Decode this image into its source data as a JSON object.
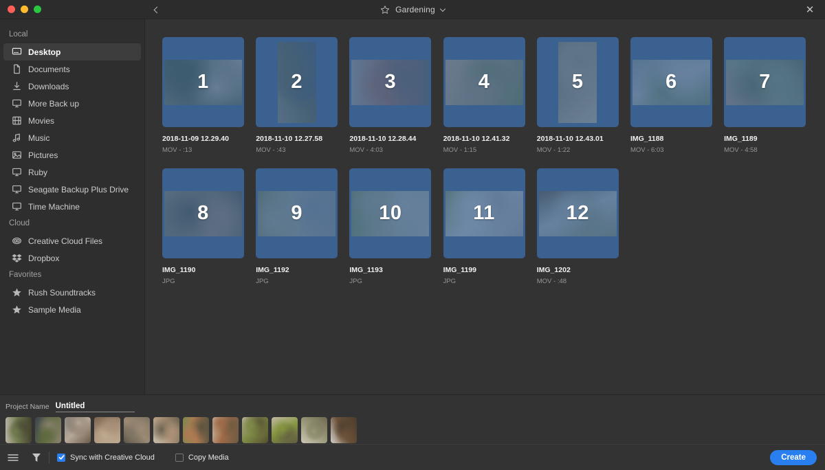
{
  "window": {
    "title": "Gardening",
    "back_icon": "chevron-left-icon",
    "favorite_icon": "star-icon",
    "dropdown_icon": "chevron-down-icon",
    "close_icon": "close-icon"
  },
  "sidebar": {
    "groups": [
      {
        "label": "Local",
        "items": [
          {
            "label": "Desktop",
            "icon": "desktop-icon",
            "selected": true
          },
          {
            "label": "Documents",
            "icon": "document-icon",
            "selected": false
          },
          {
            "label": "Downloads",
            "icon": "download-icon",
            "selected": false
          },
          {
            "label": "More Back up",
            "icon": "display-icon",
            "selected": false
          },
          {
            "label": "Movies",
            "icon": "film-icon",
            "selected": false
          },
          {
            "label": "Music",
            "icon": "music-note-icon",
            "selected": false
          },
          {
            "label": "Pictures",
            "icon": "picture-icon",
            "selected": false
          },
          {
            "label": "Ruby",
            "icon": "display-icon",
            "selected": false
          },
          {
            "label": "Seagate Backup Plus Drive",
            "icon": "display-icon",
            "selected": false
          },
          {
            "label": "Time Machine",
            "icon": "display-icon",
            "selected": false
          }
        ]
      },
      {
        "label": "Cloud",
        "items": [
          {
            "label": "Creative Cloud Files",
            "icon": "creative-cloud-icon",
            "selected": false
          },
          {
            "label": "Dropbox",
            "icon": "dropbox-icon",
            "selected": false
          }
        ]
      },
      {
        "label": "Favorites",
        "items": [
          {
            "label": "Rush Soundtracks",
            "icon": "star-filled-icon",
            "selected": false
          },
          {
            "label": "Sample Media",
            "icon": "star-filled-icon",
            "selected": false
          }
        ]
      }
    ]
  },
  "media_grid": {
    "items": [
      {
        "number": "1",
        "name": "2018-11-09 12.29.40",
        "meta": "MOV - :13",
        "aspect": "wide",
        "c1": "#4c5a4a",
        "c2": "#6d6f62",
        "c3": "#9a9a94"
      },
      {
        "number": "2",
        "name": "2018-11-10 12.27.58",
        "meta": "MOV - :43",
        "aspect": "portrait",
        "c1": "#5d6456",
        "c2": "#7d8075",
        "c3": "#49586b"
      },
      {
        "number": "3",
        "name": "2018-11-10 12.28.44",
        "meta": "MOV - 4:03",
        "aspect": "wide",
        "c1": "#8a6860",
        "c2": "#8e8e8e",
        "c3": "#5c6066"
      },
      {
        "number": "4",
        "name": "2018-11-10 12.41.32",
        "meta": "MOV - 1:15",
        "aspect": "wide",
        "c1": "#8c8476",
        "c2": "#a09684",
        "c3": "#6b7a5c"
      },
      {
        "number": "5",
        "name": "2018-11-10 12.43.01",
        "meta": "MOV - 1:22",
        "aspect": "portrait",
        "c1": "#8a8478",
        "c2": "#6e6a60",
        "c3": "#a5a096"
      },
      {
        "number": "6",
        "name": "IMG_1188",
        "meta": "MOV - 6:03",
        "aspect": "wide",
        "c1": "#9aa0a6",
        "c2": "#7e8a8e",
        "c3": "#6c8068"
      },
      {
        "number": "7",
        "name": "IMG_1189",
        "meta": "MOV - 4:58",
        "aspect": "wide",
        "c1": "#7c8a74",
        "c2": "#96867a",
        "c3": "#5f6c58"
      },
      {
        "number": "8",
        "name": "IMG_1190",
        "meta": "JPG",
        "aspect": "wide",
        "c1": "#8a7e70",
        "c2": "#6e7462",
        "c3": "#53584e"
      },
      {
        "number": "9",
        "name": "IMG_1192",
        "meta": "JPG",
        "aspect": "wide",
        "c1": "#8e948c",
        "c2": "#6f7a5e",
        "c3": "#7b8490"
      },
      {
        "number": "10",
        "name": "IMG_1193",
        "meta": "JPG",
        "aspect": "wide",
        "c1": "#8d9488",
        "c2": "#667a58",
        "c3": "#9aa0a4"
      },
      {
        "number": "11",
        "name": "IMG_1199",
        "meta": "JPG",
        "aspect": "wide",
        "c1": "#a8b0b6",
        "c2": "#7c8a6a",
        "c3": "#8e9298"
      },
      {
        "number": "12",
        "name": "IMG_1202",
        "meta": "MOV - :48",
        "aspect": "wide",
        "c1": "#9aa2a8",
        "c2": "#5e5a50",
        "c3": "#7c8470"
      }
    ]
  },
  "filmstrip": {
    "items": [
      {
        "c1": "#6f7a4e",
        "c2": "#b9b2a4",
        "c3": "#45412f"
      },
      {
        "c1": "#5f6a3e",
        "c2": "#3c4454",
        "c3": "#8a8270"
      },
      {
        "c1": "#b6a898",
        "c2": "#8c8a86",
        "c3": "#6a5a4a"
      },
      {
        "c1": "#a89078",
        "c2": "#7c6650",
        "c3": "#c0ac90"
      },
      {
        "c1": "#9b8a74",
        "c2": "#5a5448",
        "c3": "#7e7262"
      },
      {
        "c1": "#ad9278",
        "c2": "#c4bca8",
        "c3": "#6c6450"
      },
      {
        "c1": "#b07a52",
        "c2": "#7a8a50",
        "c3": "#5c5440"
      },
      {
        "c1": "#a06a46",
        "c2": "#cfc8b8",
        "c3": "#6b5a42"
      },
      {
        "c1": "#7e8a46",
        "c2": "#b8ae98",
        "c3": "#55502f"
      },
      {
        "c1": "#84963e",
        "c2": "#c2b8a2",
        "c3": "#605a42"
      },
      {
        "c1": "#9a9a7a",
        "c2": "#cdc6b4",
        "c3": "#6f6850"
      },
      {
        "c1": "#6a5038",
        "c2": "#d4cfc6",
        "c3": "#4a3c2c"
      }
    ]
  },
  "project": {
    "label": "Project Name",
    "value": "Untitled",
    "placeholder": "Untitled"
  },
  "statusbar": {
    "list_icon": "list-view-icon",
    "filter_icon": "filter-icon",
    "sync_label": "Sync with Creative Cloud",
    "sync_checked": true,
    "copy_label": "Copy Media",
    "copy_checked": false,
    "create_label": "Create"
  },
  "colors": {
    "accent": "#2a7ff0",
    "selection_blue": "#3a618f",
    "sidebar_bg": "#2e2e2e",
    "content_bg": "#333333",
    "titlebar_bg": "#2c2c2c"
  }
}
